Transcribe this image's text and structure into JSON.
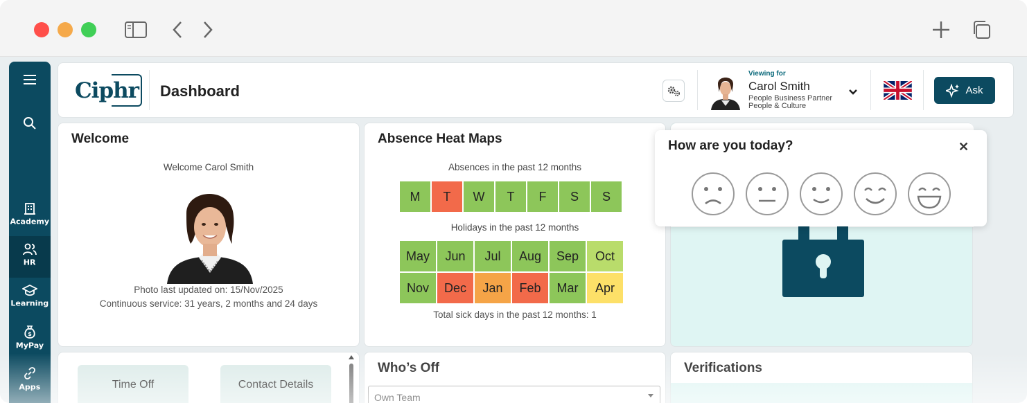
{
  "sidebar": {
    "items": [
      {
        "label": "",
        "icon": "menu-icon"
      },
      {
        "label": "",
        "icon": "search-icon"
      },
      {
        "label": "Academy",
        "icon": "building-icon"
      },
      {
        "label": "HR",
        "icon": "people-icon"
      },
      {
        "label": "Learning",
        "icon": "graduation-cap-icon"
      },
      {
        "label": "MyPay",
        "icon": "money-bag-icon"
      },
      {
        "label": "Apps",
        "icon": "link-icon"
      }
    ],
    "active": "HR",
    "color": "#0c4a60"
  },
  "header": {
    "logo": "Ciphr",
    "title": "Dashboard",
    "viewing_for": "Viewing for",
    "user_name": "Carol Smith",
    "user_role": "People Business Partner",
    "user_dept": "People & Culture",
    "ask_label": "Ask"
  },
  "welcome": {
    "title": "Welcome",
    "greeting": "Welcome Carol Smith",
    "photo_updated": "Photo last updated on: 15/Nov/2025",
    "service": "Continuous service: 31 years, 2 months and 24 days"
  },
  "absence": {
    "title": "Absence Heat Maps",
    "absences_caption": "Absences in the past 12 months",
    "days": [
      {
        "label": "M",
        "color": "green"
      },
      {
        "label": "T",
        "color": "red"
      },
      {
        "label": "W",
        "color": "green"
      },
      {
        "label": "T",
        "color": "green"
      },
      {
        "label": "F",
        "color": "green"
      },
      {
        "label": "S",
        "color": "green"
      },
      {
        "label": "S",
        "color": "green"
      }
    ],
    "holidays_caption": "Holidays in the past 12 months",
    "months_row1": [
      {
        "label": "May",
        "color": "green"
      },
      {
        "label": "Jun",
        "color": "green"
      },
      {
        "label": "Jul",
        "color": "green"
      },
      {
        "label": "Aug",
        "color": "green"
      },
      {
        "label": "Sep",
        "color": "green"
      },
      {
        "label": "Oct",
        "color": "lime"
      }
    ],
    "months_row2": [
      {
        "label": "Nov",
        "color": "green"
      },
      {
        "label": "Dec",
        "color": "red"
      },
      {
        "label": "Jan",
        "color": "orange"
      },
      {
        "label": "Feb",
        "color": "red"
      },
      {
        "label": "Mar",
        "color": "green"
      },
      {
        "label": "Apr",
        "color": "yellow"
      }
    ],
    "sick_days": "Total sick days in the past 12 months: 1"
  },
  "mood": {
    "title": "How are you today?",
    "faces": [
      "sad-face-icon",
      "neutral-face-icon",
      "slight-smile-face-icon",
      "smile-face-icon",
      "grin-face-icon"
    ]
  },
  "tiles": {
    "time_off": "Time Off",
    "contact_details": "Contact Details"
  },
  "whos_off": {
    "title": "Who’s Off",
    "filter_value": "Own Team"
  },
  "verifications": {
    "title": "Verifications"
  }
}
